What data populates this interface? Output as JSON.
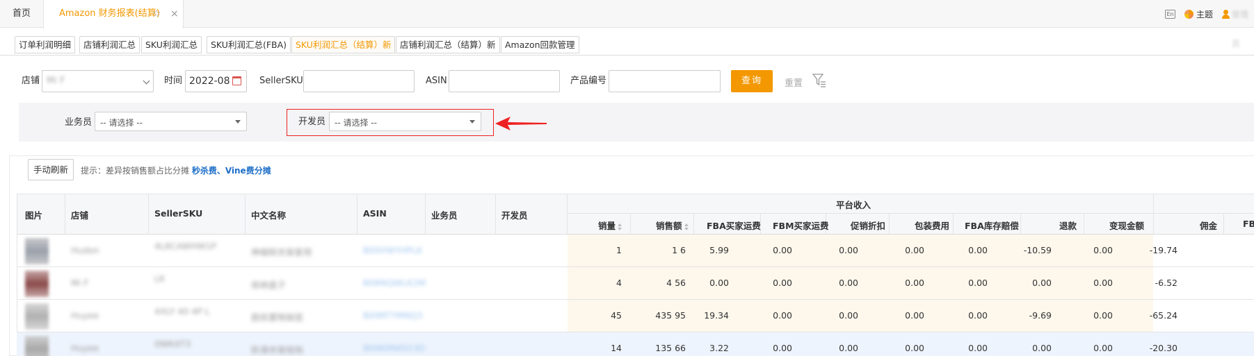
{
  "topbar": {
    "home_tab": "首页",
    "report_tab": "Amazon 财务报表(结算)",
    "star_icon": "☆",
    "close_icon": "×",
    "lang_icon": "En",
    "theme_label": "主题",
    "user_name": "管理员"
  },
  "subtabs": [
    {
      "label": "订单利润明细"
    },
    {
      "label": "店铺利润汇总"
    },
    {
      "label": "SKU利润汇总"
    },
    {
      "label": "SKU利润汇总(FBA)"
    },
    {
      "label": "SKU利润汇总（结算）新"
    },
    {
      "label": "店铺利润汇总（结算）新"
    },
    {
      "label": "Amazon回款管理"
    }
  ],
  "filters": {
    "store_label": "店铺",
    "store_value": "Mi  F",
    "time_label": "时间",
    "time_value": "2022-08",
    "sellersku_label": "SellerSKU",
    "asin_label": "ASIN",
    "product_code_label": "产品编号",
    "query_button": "查询",
    "reset_button": "重置",
    "salesman_label": "业务员",
    "salesman_value": "-- 请选择 --",
    "developer_label": "开发员",
    "developer_value": "-- 请选择 --"
  },
  "toolbar": {
    "refresh_button": "手动刷新",
    "hint_prefix": "提示：差异按销售额占比分摊 ",
    "hint_bold": "秒杀费、Vine费分摊"
  },
  "table": {
    "group_platform_income": "平台收入",
    "left_headers": [
      "图片",
      "店铺",
      "SellerSKU",
      "中文名称",
      "ASIN",
      "业务员",
      "开发员"
    ],
    "right_headers": [
      "销量",
      "销售额",
      "FBA买家运费",
      "FBM买家运费",
      "促销折扣",
      "包装费用",
      "FBA库存赔偿",
      "退款",
      "变现金额",
      "佣金",
      "FB"
    ],
    "rows": [
      {
        "store": "Hudon",
        "sku": "4L8CAWHW1P",
        "name": "伸缩晾衣架家用",
        "asin": "B09XWYHPLK",
        "qty": "1",
        "sales": "1 6",
        "fba_ship": "5.99",
        "fbm_ship": "0.00",
        "promo": "0.00",
        "pack": "0.00",
        "fba_comp": "0.00",
        "refund": "-10.59",
        "cash": "0.00",
        "commission": "-19.74"
      },
      {
        "store": "Mi F",
        "sku": "LK     ",
        "name": "收纳盒子",
        "asin": "B08NQWLK2M",
        "qty": "4",
        "sales": "4 56",
        "fba_ship": "0.00",
        "fbm_ship": "0.00",
        "promo": "0.00",
        "pack": "0.00",
        "fba_comp": "0.00",
        "refund": "0.00",
        "cash": "0.00",
        "commission": "-6.52"
      },
      {
        "store": "Huyee",
        "sku": "4XLY 40 4P L",
        "name": "厨房置物架层",
        "asin": "B09RTYMNQ3",
        "qty": "45",
        "sales": "435 95",
        "fba_ship": "19.34",
        "fbm_ship": "0.00",
        "promo": "0.00",
        "pack": "0.00",
        "fba_comp": "0.00",
        "refund": "-9.69",
        "cash": "0.00",
        "commission": "-65.24"
      },
      {
        "store": "Huyee",
        "sku": "0WK4T3     ",
        "name": "防滑衣架挂钩",
        "asin": "B09KMWS53D",
        "qty": "14",
        "sales": "135 66",
        "fba_ship": "3.22",
        "fbm_ship": "0.00",
        "promo": "0.00",
        "pack": "0.00",
        "fba_comp": "0.00",
        "refund": "0.00",
        "cash": "0.00",
        "commission": "-20.30"
      }
    ]
  },
  "colors": {
    "accent": "#f39800",
    "link": "#1e6fc8",
    "annotation": "#e22222",
    "income_bg": "#fdf7ec"
  }
}
